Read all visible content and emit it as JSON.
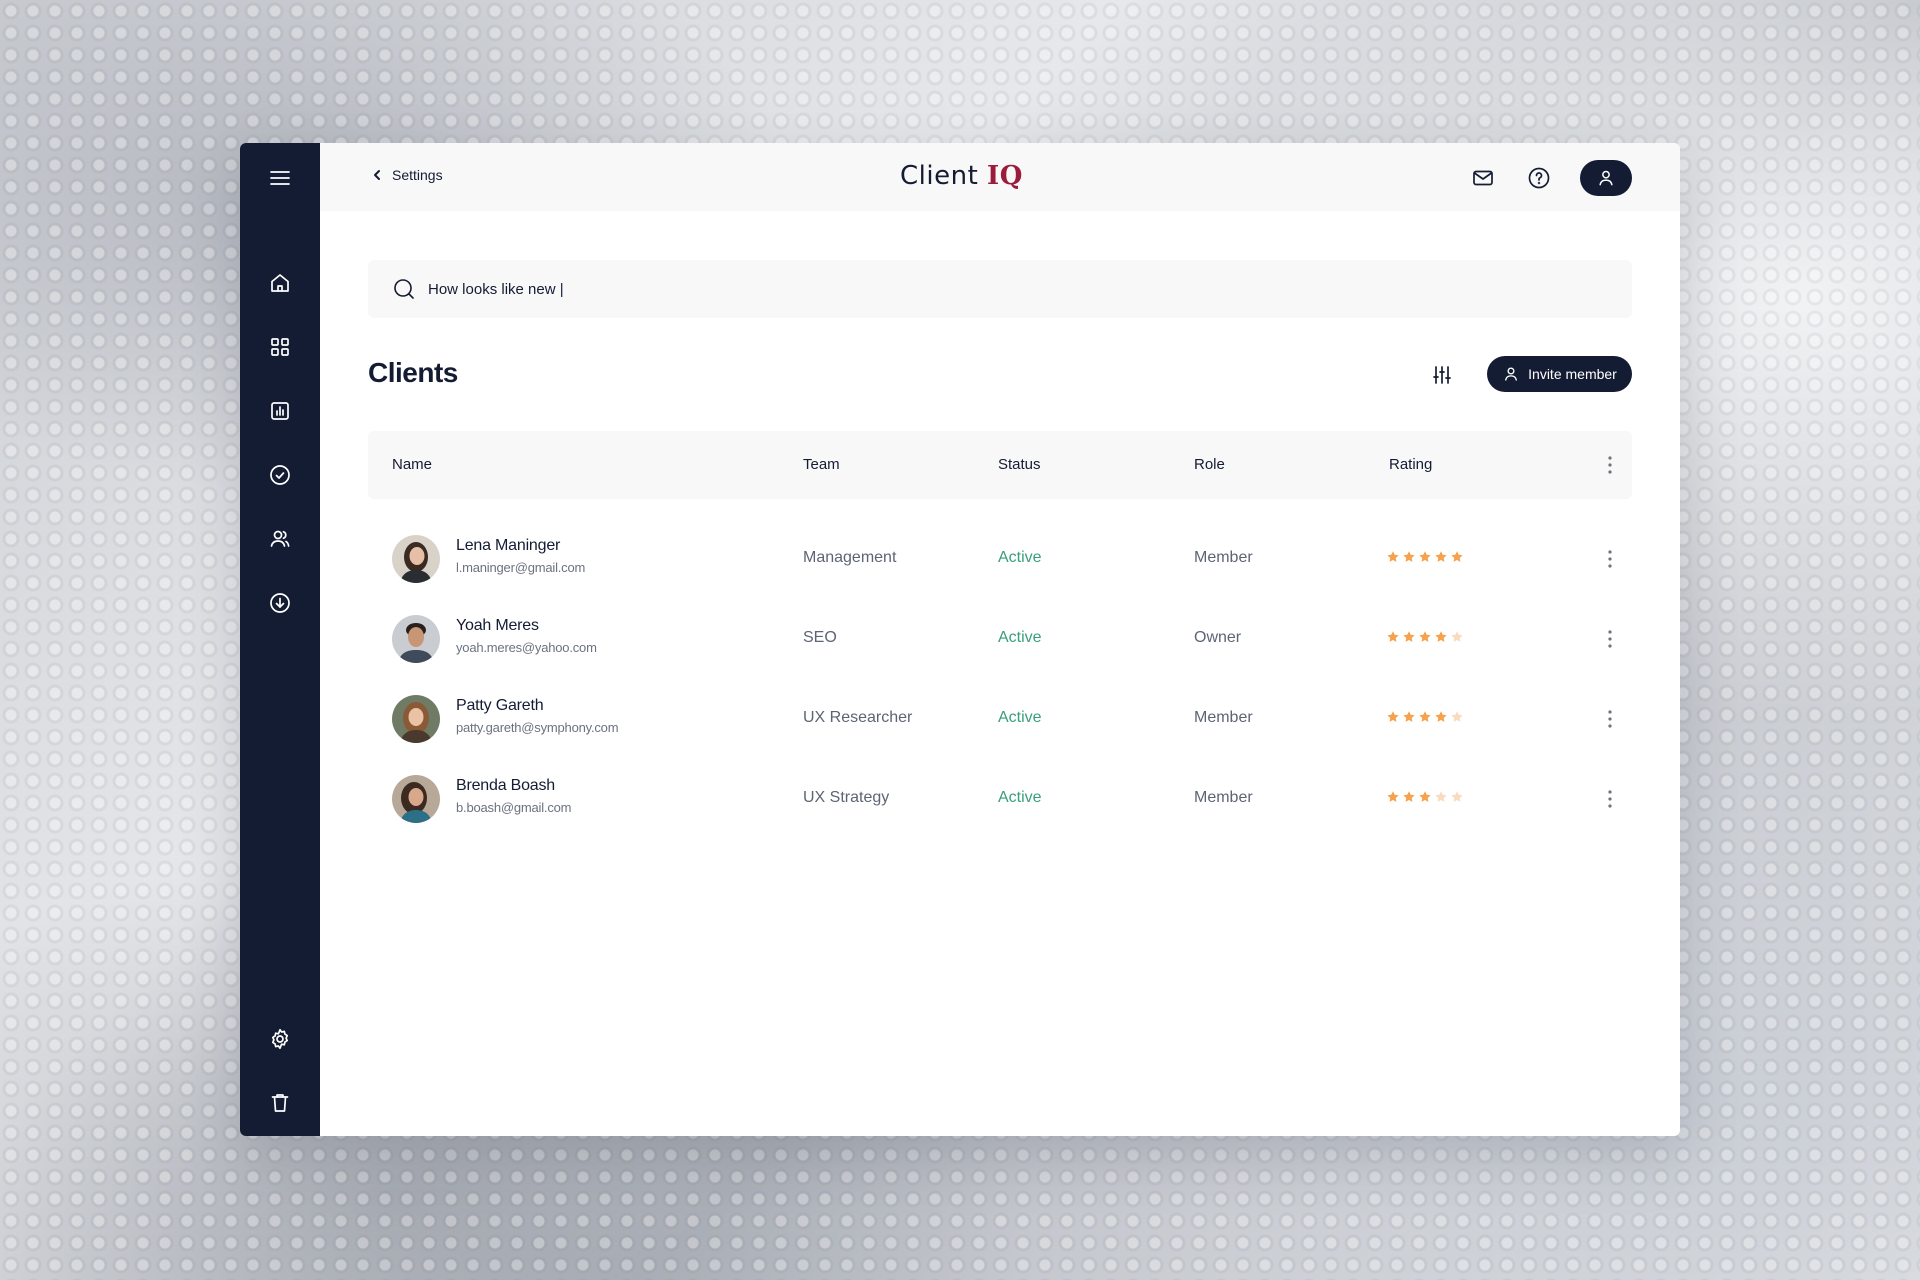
{
  "app": {
    "brand": "Client",
    "brand_accent": "IQ",
    "brand_accent_color": "#9b1b3a",
    "primary_color": "#141c33",
    "status_color": "#3aa07a",
    "star_color": "#f5a24b"
  },
  "sidebar": {
    "items": [
      {
        "icon": "menu-icon"
      },
      {
        "icon": "home-icon"
      },
      {
        "icon": "dashboard-grid-icon"
      },
      {
        "icon": "bar-chart-icon"
      },
      {
        "icon": "check-circle-icon"
      },
      {
        "icon": "users-icon"
      },
      {
        "icon": "download-circle-icon"
      },
      {
        "icon": "gear-icon"
      },
      {
        "icon": "trash-icon"
      }
    ]
  },
  "header": {
    "back_label": "Settings",
    "icons": [
      "mail-icon",
      "help-icon",
      "profile-icon"
    ]
  },
  "search": {
    "value": "How looks like new |"
  },
  "page": {
    "title": "Clients",
    "invite_label": "Invite member"
  },
  "table": {
    "columns": [
      "Name",
      "Team",
      "Status",
      "Role",
      "Rating"
    ],
    "rows": [
      {
        "name": "Lena Maninger",
        "email": "l.maninger@gmail.com",
        "team": "Management",
        "status": "Active",
        "role": "Member",
        "rating": 5
      },
      {
        "name": "Yoah Meres",
        "email": "yoah.meres@yahoo.com",
        "team": "SEO",
        "status": "Active",
        "role": "Owner",
        "rating": 4
      },
      {
        "name": "Patty Gareth",
        "email": "patty.gareth@symphony.com",
        "team": "UX Researcher",
        "status": "Active",
        "role": "Member",
        "rating": 4
      },
      {
        "name": "Brenda Boash",
        "email": "b.boash@gmail.com",
        "team": "UX Strategy",
        "status": "Active",
        "role": "Member",
        "rating": 3
      }
    ],
    "rating_max": 5
  }
}
